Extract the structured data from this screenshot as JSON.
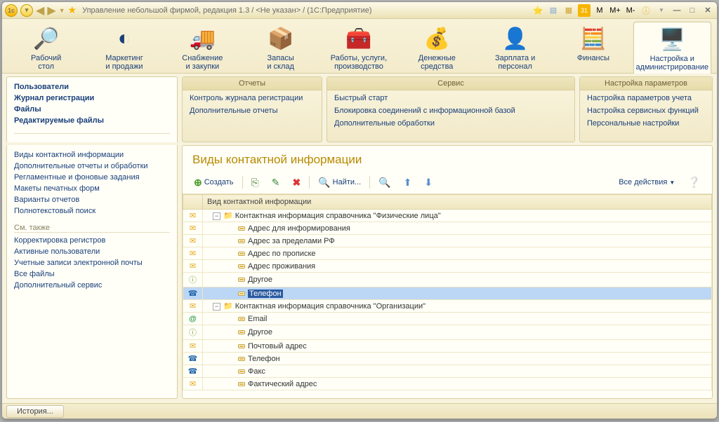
{
  "title": "Управление небольшой фирмой, редакция 1.3 / <Не указан> / (1С:Предприятие)",
  "mbuttons": [
    "M",
    "M+",
    "M-"
  ],
  "sections": [
    {
      "label": "Рабочий\nстол",
      "icon": "🔎"
    },
    {
      "label": "Маркетинг\nи продажи",
      "icon": "◐"
    },
    {
      "label": "Снабжение\nи закупки",
      "icon": "🚚"
    },
    {
      "label": "Запасы\nи склад",
      "icon": "📦"
    },
    {
      "label": "Работы, услуги,\nпроизводство",
      "icon": "🧰"
    },
    {
      "label": "Денежные\nсредства",
      "icon": "💰"
    },
    {
      "label": "Зарплата и\nперсонал",
      "icon": "👤"
    },
    {
      "label": "Финансы",
      "icon": "🧮"
    },
    {
      "label": "Настройка и\nадминистрирование",
      "icon": "🖥️",
      "active": true
    }
  ],
  "panels": {
    "reports": {
      "title": "Отчеты",
      "items": [
        "Контроль журнала регистрации",
        "Дополнительные отчеты"
      ]
    },
    "service": {
      "title": "Сервис",
      "items": [
        "Быстрый старт",
        "Блокировка соединений с информационной базой",
        "Дополнительные обработки"
      ]
    },
    "settings": {
      "title": "Настройка параметров",
      "items": [
        "Настройка параметров учета",
        "Настройка сервисных функций",
        "Персональные настройки"
      ]
    }
  },
  "sidebar": {
    "group1": [
      {
        "label": "Пользователи",
        "bold": true
      },
      {
        "label": "Журнал регистрации",
        "bold": true
      },
      {
        "label": "Файлы",
        "bold": true
      },
      {
        "label": "Редактируемые файлы",
        "bold": true
      }
    ],
    "group2": [
      "Виды контактной информации",
      "Дополнительные отчеты и обработки",
      "Регламентные и фоновые задания",
      "Макеты печатных форм",
      "Варианты отчетов",
      "Полнотекстовый поиск"
    ],
    "seealso_hdr": "См. также",
    "group3": [
      "Корректировка регистров",
      "Активные пользователи",
      "Учетные записи электронной почты",
      "Все файлы",
      "Дополнительный сервис"
    ]
  },
  "main": {
    "title": "Виды контактной информации",
    "toolbar": {
      "create": "Создать",
      "find": "Найти...",
      "all": "Все действия"
    },
    "col_header": "Вид контактной информации",
    "rows": [
      {
        "icon": "mail",
        "depth": 0,
        "expander": "-",
        "folder": true,
        "text": "Контактная информация справочника \"Физические лица\""
      },
      {
        "icon": "mail",
        "depth": 1,
        "leaf": true,
        "text": "Адрес для информирования"
      },
      {
        "icon": "mail",
        "depth": 1,
        "leaf": true,
        "text": "Адрес за пределами РФ"
      },
      {
        "icon": "mail",
        "depth": 1,
        "leaf": true,
        "text": "Адрес по прописке"
      },
      {
        "icon": "mail",
        "depth": 1,
        "leaf": true,
        "text": "Адрес проживания"
      },
      {
        "icon": "home",
        "depth": 1,
        "leaf": true,
        "text": "Другое"
      },
      {
        "icon": "phone",
        "depth": 1,
        "leaf": true,
        "text": "Телефон",
        "selected": true
      },
      {
        "icon": "mail",
        "depth": 0,
        "expander": "-",
        "folder": true,
        "text": "Контактная информация справочника \"Организации\""
      },
      {
        "icon": "at",
        "depth": 1,
        "leaf": true,
        "text": "Email"
      },
      {
        "icon": "home",
        "depth": 1,
        "leaf": true,
        "text": "Другое"
      },
      {
        "icon": "mail",
        "depth": 1,
        "leaf": true,
        "text": "Почтовый адрес"
      },
      {
        "icon": "phone",
        "depth": 1,
        "leaf": true,
        "text": "Телефон"
      },
      {
        "icon": "phone",
        "depth": 1,
        "leaf": true,
        "text": "Факс"
      },
      {
        "icon": "mail",
        "depth": 1,
        "leaf": true,
        "text": "Фактический адрес"
      }
    ]
  },
  "status": {
    "history": "История..."
  }
}
